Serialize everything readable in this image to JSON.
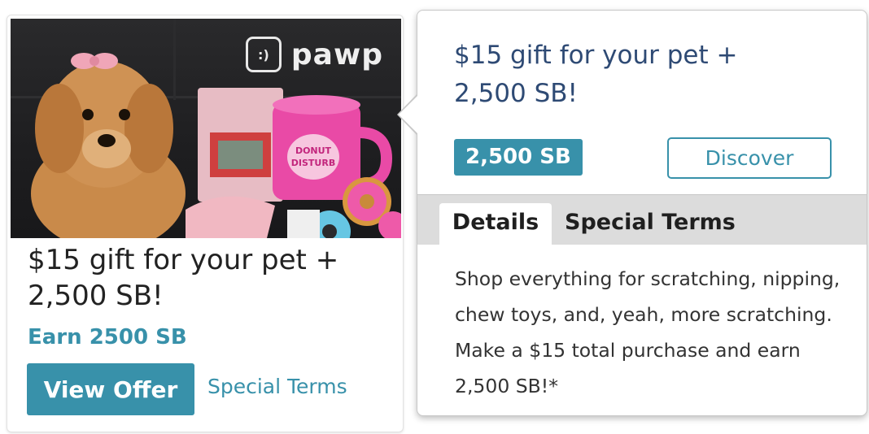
{
  "card": {
    "brand_logo_text": "pawp",
    "brand_logo_glyph": ":)",
    "product_mug_text": "DONUT DISTURB",
    "title": "$15 gift for your pet + 2,500 SB!",
    "earn_label": "Earn 2500 SB",
    "view_offer_label": "View Offer",
    "special_terms_link": "Special Terms"
  },
  "popover": {
    "title": "$15 gift for your pet + 2,500 SB!",
    "sb_badge": "2,500 SB",
    "discover_label": "Discover",
    "tabs": [
      {
        "label": "Details",
        "active": true
      },
      {
        "label": "Special Terms",
        "active": false
      }
    ],
    "details_text": "Shop everything for scratching, nipping, chew toys, and, yeah, more scratching. Make a $15 total purchase and earn 2,500 SB!*"
  },
  "colors": {
    "accent": "#3891aa",
    "title_blue": "#2e4a74",
    "tabbar_gray": "#dcdcdc"
  }
}
